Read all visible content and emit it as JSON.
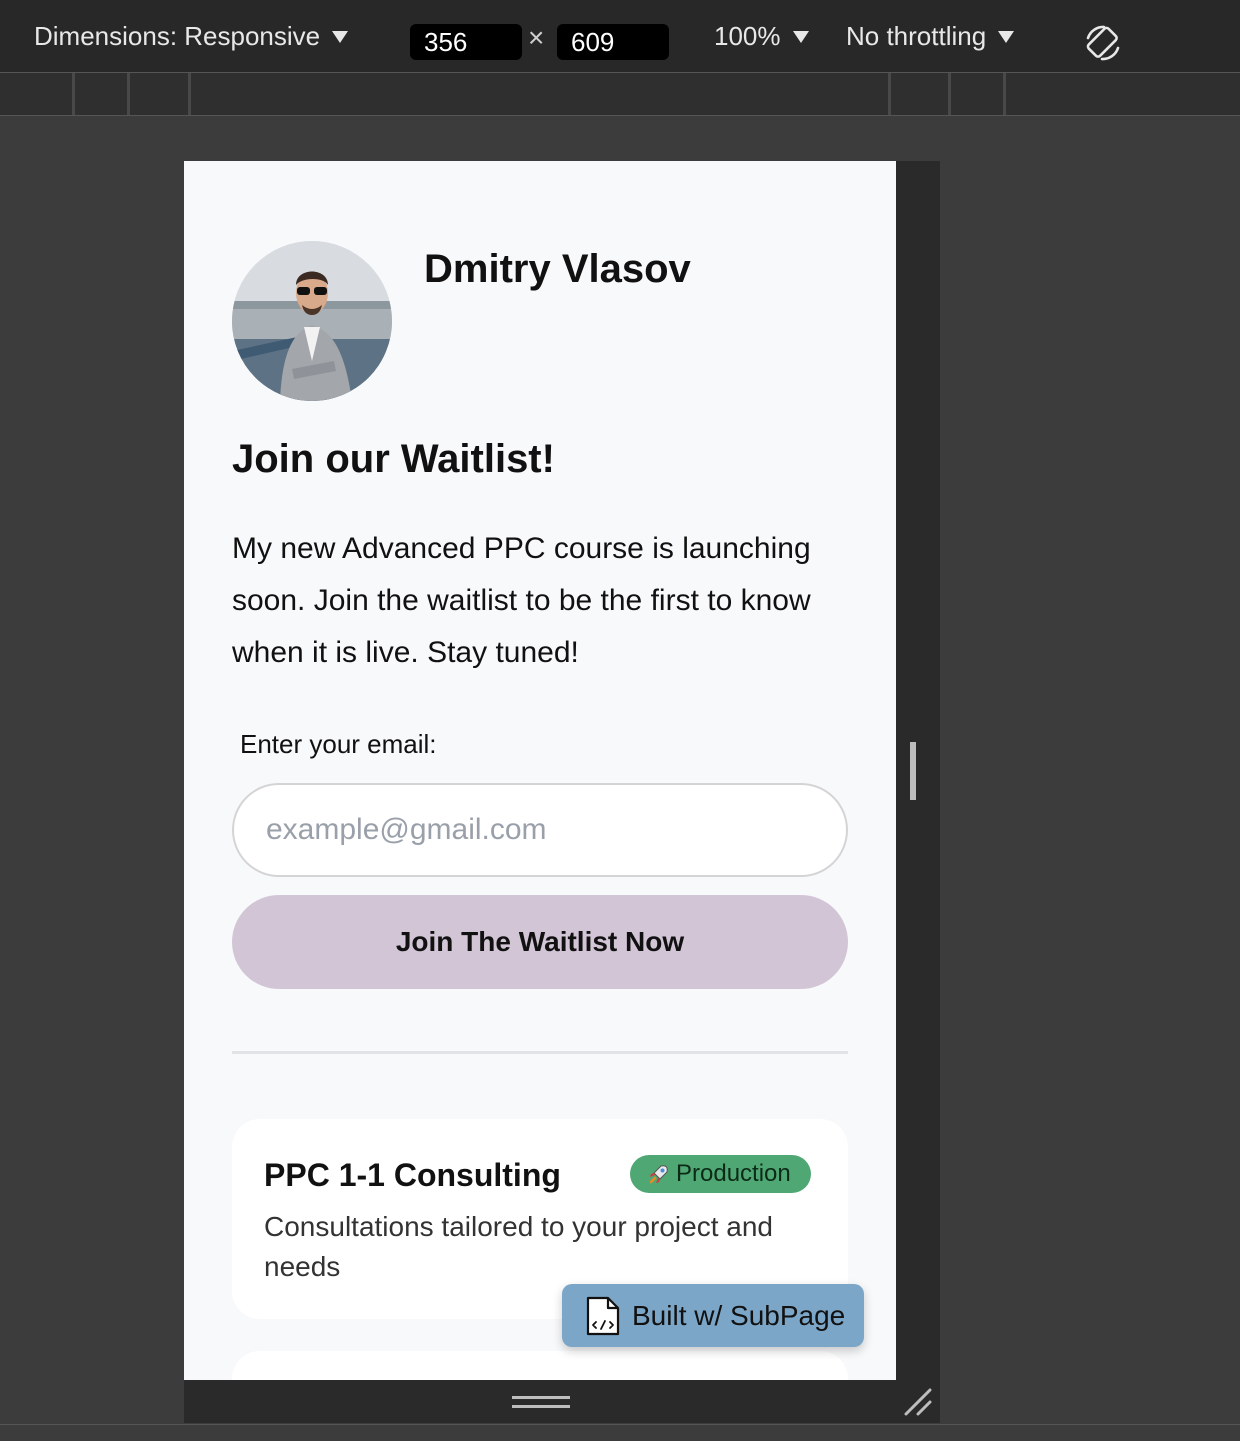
{
  "devtools": {
    "dimensions_label": "Dimensions: Responsive",
    "width_value": "356",
    "times_symbol": "×",
    "height_value": "609",
    "zoom": "100%",
    "throttling": "No throttling"
  },
  "page": {
    "profile_name": "Dmitry Vlasov",
    "heading": "Join our Waitlist!",
    "description": "My new Advanced PPC course is launching soon. Join the waitlist to be the first to know when it is live. Stay tuned!",
    "email_label": "Enter your email:",
    "email_placeholder": "example@gmail.com",
    "email_value": "",
    "join_button": "Join The Waitlist Now",
    "cards": [
      {
        "title": "PPC 1-1 Consulting",
        "badge": "Production",
        "badge_icon": "rocket-icon",
        "badge_color": "#4fa874",
        "description": "Consultations tailored to your project and needs"
      }
    ],
    "built_with": "Built w/ SubPage"
  },
  "colors": {
    "button_bg": "#d2c5d6",
    "built_bg": "#7ba6c8",
    "page_bg": "#f8f9fb"
  }
}
